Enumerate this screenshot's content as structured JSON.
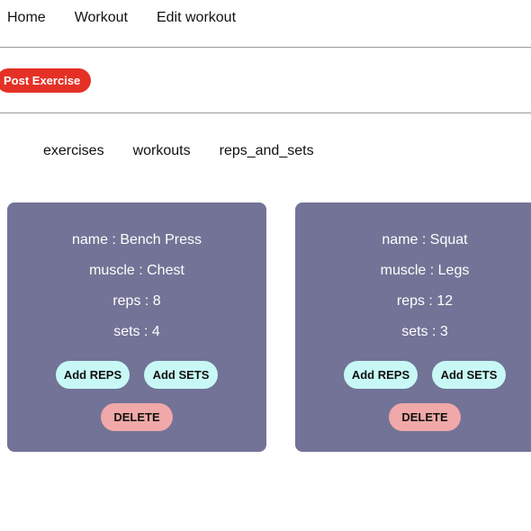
{
  "nav": {
    "items": [
      {
        "label": "Home"
      },
      {
        "label": "Workout"
      },
      {
        "label": "Edit workout"
      }
    ]
  },
  "post_button": {
    "label": "Post Exercise",
    "color": "#e53125"
  },
  "tabs": {
    "items": [
      {
        "label": "exercises"
      },
      {
        "label": "workouts"
      },
      {
        "label": "reps_and_sets"
      }
    ]
  },
  "colors": {
    "card_bg": "#727396",
    "add_button_bg": "#c8f8f6",
    "delete_button_bg": "#f0a8a8"
  },
  "cards": [
    {
      "name": "name : Bench Press",
      "muscle": "muscle : Chest",
      "reps": "reps : 8",
      "sets": "sets : 4",
      "add_reps_label": "Add REPS",
      "add_sets_label": "Add SETS",
      "delete_label": "DELETE"
    },
    {
      "name": "name : Squat",
      "muscle": "muscle : Legs",
      "reps": "reps : 12",
      "sets": "sets : 3",
      "add_reps_label": "Add REPS",
      "add_sets_label": "Add SETS",
      "delete_label": "DELETE"
    }
  ]
}
